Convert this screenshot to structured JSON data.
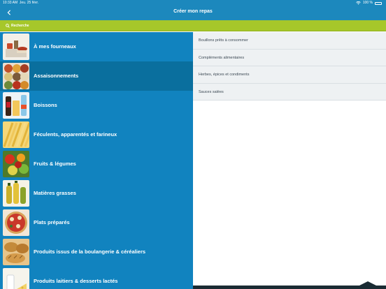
{
  "status": {
    "time": "10:33 AM",
    "date": "Jeu. 25 févr.",
    "battery": "100 %"
  },
  "nav": {
    "back_icon": "chevron-left-icon",
    "title": "Créer mon repas"
  },
  "search": {
    "label": "Recherche",
    "icon": "search-icon"
  },
  "colors": {
    "brand_blue": "#1c88bd",
    "list_blue": "#1183bf",
    "selected_blue": "#0a6f9e",
    "search_green": "#a6c72a"
  },
  "categories": [
    {
      "label": "À mes fourneaux",
      "image": "kitchen-image"
    },
    {
      "label": "Assaisonnements",
      "image": "spices-image",
      "selected": true
    },
    {
      "label": "Boissons",
      "image": "drinks-image"
    },
    {
      "label": "Féculents, apparentés et farineux",
      "image": "pasta-image"
    },
    {
      "label": "Fruits & légumes",
      "image": "vegetables-image"
    },
    {
      "label": "Matières grasses",
      "image": "oils-image"
    },
    {
      "label": "Plats préparés",
      "image": "pizza-image"
    },
    {
      "label": "Produits issus de la boulangerie & céréaliers",
      "image": "bread-image"
    },
    {
      "label": "Produits laitiers & desserts lactés",
      "image": "dairy-image"
    }
  ],
  "subcategories": [
    "Bouillons prêts à consommer",
    "Compléments alimentaires",
    "Herbes, épices et condiments",
    "Sauces salées"
  ]
}
